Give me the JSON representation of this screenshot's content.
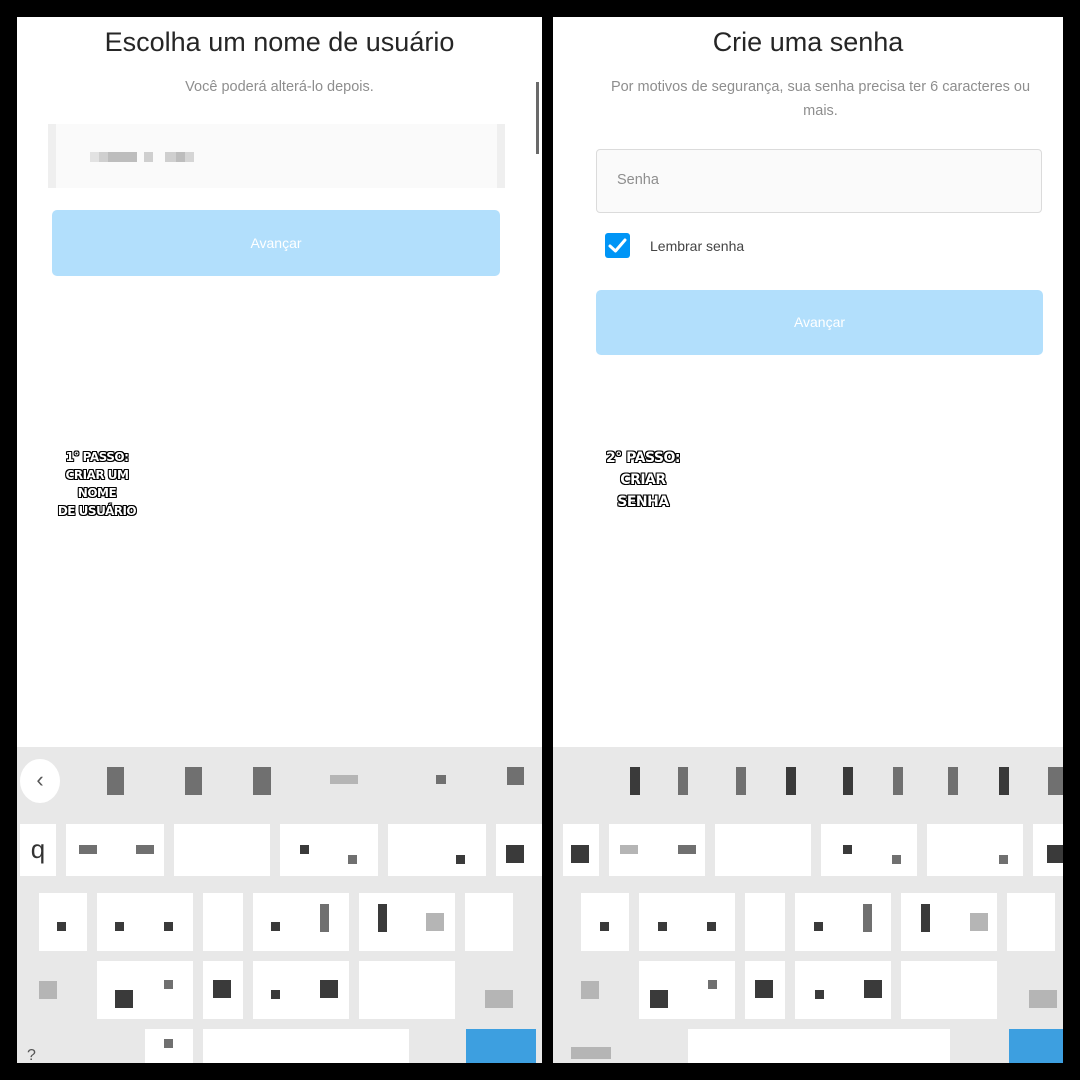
{
  "left_screen": {
    "title": "Escolha um nome de usuário",
    "subtitle": "Você poderá alterá-lo depois.",
    "button_label": "Avançar",
    "caption_lines": [
      "1° PASSO:",
      "CRIAR UM NOME",
      "DE USUÁRIO"
    ]
  },
  "right_screen": {
    "title": "Crie uma senha",
    "subtitle": "Por motivos de segurança, sua senha precisa ter 6 caracteres ou mais.",
    "password_placeholder": "Senha",
    "remember_label": "Lembrar senha",
    "remember_checked": true,
    "button_label": "Avançar",
    "caption_lines": [
      "2° PASSO:",
      "CRIAR SENHA"
    ]
  },
  "keyboard": {
    "back_glyph": "‹",
    "first_key_glyph": "q",
    "symbol_key_glyph": "?"
  },
  "colors": {
    "button_disabled": "#b2dffc",
    "checkbox": "#0095f6",
    "enter_key": "#3d9fe0"
  }
}
